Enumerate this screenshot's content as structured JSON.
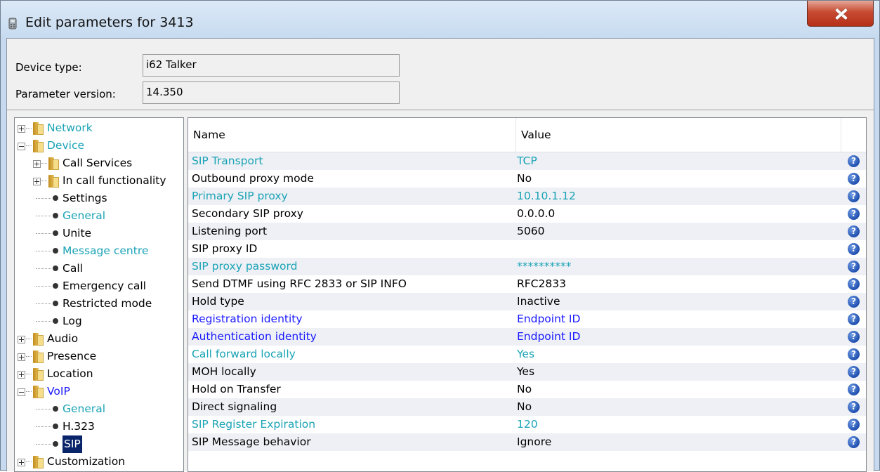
{
  "window": {
    "title": "Edit parameters for 3413",
    "close_label": "X"
  },
  "device_type": {
    "label": "Device type:",
    "value": "i62 Talker"
  },
  "parameter_version": {
    "label": "Parameter version:",
    "value": "14.350"
  },
  "tree": {
    "items": [
      {
        "label": "Network",
        "kind": "folder",
        "level": 0,
        "expander": "plus",
        "color": "cyan"
      },
      {
        "label": "Device",
        "kind": "folder",
        "level": 0,
        "expander": "minus",
        "color": "cyan"
      },
      {
        "label": "Call Services",
        "kind": "folder",
        "level": 1,
        "expander": "plus",
        "color": "black"
      },
      {
        "label": "In call functionality",
        "kind": "folder",
        "level": 1,
        "expander": "plus",
        "color": "black"
      },
      {
        "label": "Settings",
        "kind": "leaf",
        "level": 1,
        "color": "black"
      },
      {
        "label": "General",
        "kind": "leaf",
        "level": 1,
        "color": "cyan"
      },
      {
        "label": "Unite",
        "kind": "leaf",
        "level": 1,
        "color": "black"
      },
      {
        "label": "Message centre",
        "kind": "leaf",
        "level": 1,
        "color": "cyan"
      },
      {
        "label": "Call",
        "kind": "leaf",
        "level": 1,
        "color": "black"
      },
      {
        "label": "Emergency call",
        "kind": "leaf",
        "level": 1,
        "color": "black"
      },
      {
        "label": "Restricted mode",
        "kind": "leaf",
        "level": 1,
        "color": "black"
      },
      {
        "label": "Log",
        "kind": "leaf",
        "level": 1,
        "color": "black"
      },
      {
        "label": "Audio",
        "kind": "folder",
        "level": 0,
        "expander": "plus",
        "color": "black"
      },
      {
        "label": "Presence",
        "kind": "folder",
        "level": 0,
        "expander": "plus",
        "color": "black"
      },
      {
        "label": "Location",
        "kind": "folder",
        "level": 0,
        "expander": "plus",
        "color": "black"
      },
      {
        "label": "VoIP",
        "kind": "folder",
        "level": 0,
        "expander": "minus",
        "color": "blue"
      },
      {
        "label": "General",
        "kind": "leaf",
        "level": 1,
        "color": "cyan"
      },
      {
        "label": "H.323",
        "kind": "leaf",
        "level": 1,
        "color": "black"
      },
      {
        "label": "SIP",
        "kind": "leaf",
        "level": 1,
        "color": "black",
        "selected": true
      },
      {
        "label": "Customization",
        "kind": "folder",
        "level": 0,
        "expander": "plus",
        "color": "black"
      }
    ]
  },
  "table": {
    "columns": {
      "name": "Name",
      "value": "Value"
    },
    "help_glyph": "?",
    "rows": [
      {
        "name": "SIP Transport",
        "value": "TCP",
        "color": "cyan"
      },
      {
        "name": "Outbound proxy mode",
        "value": "No",
        "color": "black"
      },
      {
        "name": "Primary SIP proxy",
        "value": "10.10.1.12",
        "color": "cyan"
      },
      {
        "name": "Secondary SIP proxy",
        "value": "0.0.0.0",
        "color": "black"
      },
      {
        "name": "Listening port",
        "value": "5060",
        "color": "black"
      },
      {
        "name": "SIP proxy ID",
        "value": "",
        "color": "black"
      },
      {
        "name": "SIP proxy password",
        "value": "**********",
        "color": "cyan"
      },
      {
        "name": "Send DTMF using RFC 2833 or SIP INFO",
        "value": "RFC2833",
        "color": "black"
      },
      {
        "name": "Hold type",
        "value": "Inactive",
        "color": "black"
      },
      {
        "name": "Registration identity",
        "value": "Endpoint ID",
        "color": "blue"
      },
      {
        "name": "Authentication identity",
        "value": "Endpoint ID",
        "color": "blue"
      },
      {
        "name": "Call forward locally",
        "value": "Yes",
        "color": "cyan"
      },
      {
        "name": "MOH locally",
        "value": "Yes",
        "color": "black"
      },
      {
        "name": "Hold on Transfer",
        "value": "No",
        "color": "black"
      },
      {
        "name": "Direct signaling",
        "value": "No",
        "color": "black"
      },
      {
        "name": "SIP Register Expiration",
        "value": "120",
        "color": "cyan"
      },
      {
        "name": "SIP Message behavior",
        "value": "Ignore",
        "color": "black"
      }
    ]
  },
  "colors": {
    "cyan": "#1aa3b5",
    "blue": "#1a1aff",
    "black": "#000000",
    "selection": "#0a246a"
  }
}
